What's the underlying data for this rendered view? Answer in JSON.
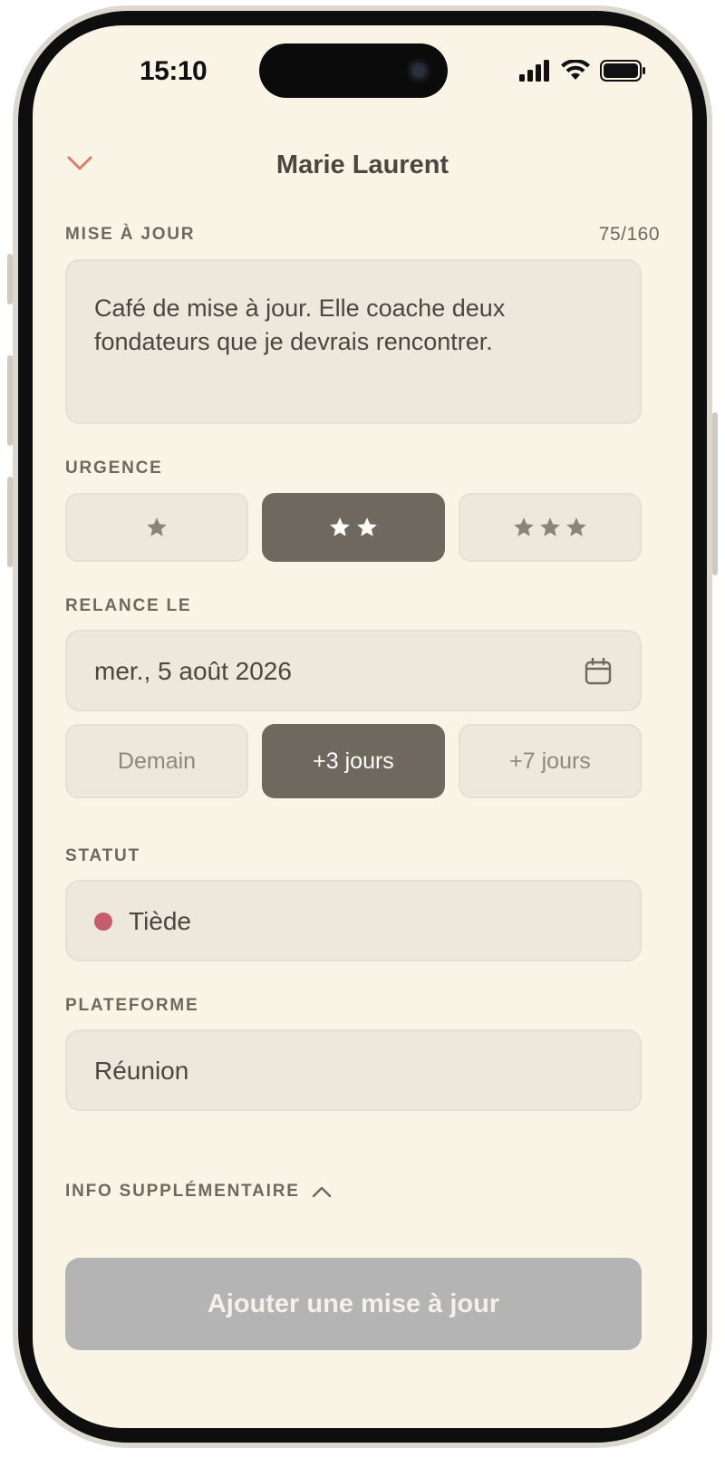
{
  "status_bar": {
    "time": "15:10",
    "icons": [
      "signal-icon",
      "wifi-icon",
      "battery-icon"
    ]
  },
  "header": {
    "title": "Marie Laurent",
    "back_icon": "chevron-down-icon"
  },
  "update": {
    "label": "MISE À JOUR",
    "counter": "75/160",
    "text": "Café de mise à jour. Elle coache deux fondateurs que je devrais rencontrer."
  },
  "urgency": {
    "label": "URGENCE",
    "options": [
      {
        "stars": 1,
        "selected": false
      },
      {
        "stars": 2,
        "selected": true
      },
      {
        "stars": 3,
        "selected": false
      }
    ]
  },
  "follow_up": {
    "label": "RELANCE LE",
    "date": "mer., 5 août 2026",
    "date_icon": "calendar-icon",
    "quick_options": [
      {
        "label": "Demain",
        "selected": false
      },
      {
        "label": "+3 jours",
        "selected": true
      },
      {
        "label": "+7 jours",
        "selected": false
      }
    ]
  },
  "status": {
    "label": "STATUT",
    "value": "Tiède",
    "dot_color": "#c65d6c"
  },
  "platform": {
    "label": "PLATEFORME",
    "value": "Réunion"
  },
  "extra_info": {
    "label": "INFO SUPPLÉMENTAIRE",
    "toggle_icon": "chevron-up-icon"
  },
  "submit": {
    "label": "Ajouter une mise à jour"
  },
  "colors": {
    "background": "#f9f4e5",
    "field": "#eee7dc",
    "selected": "#6e685f",
    "accent": "#e07b66",
    "button_disabled": "#b4b4b4"
  }
}
